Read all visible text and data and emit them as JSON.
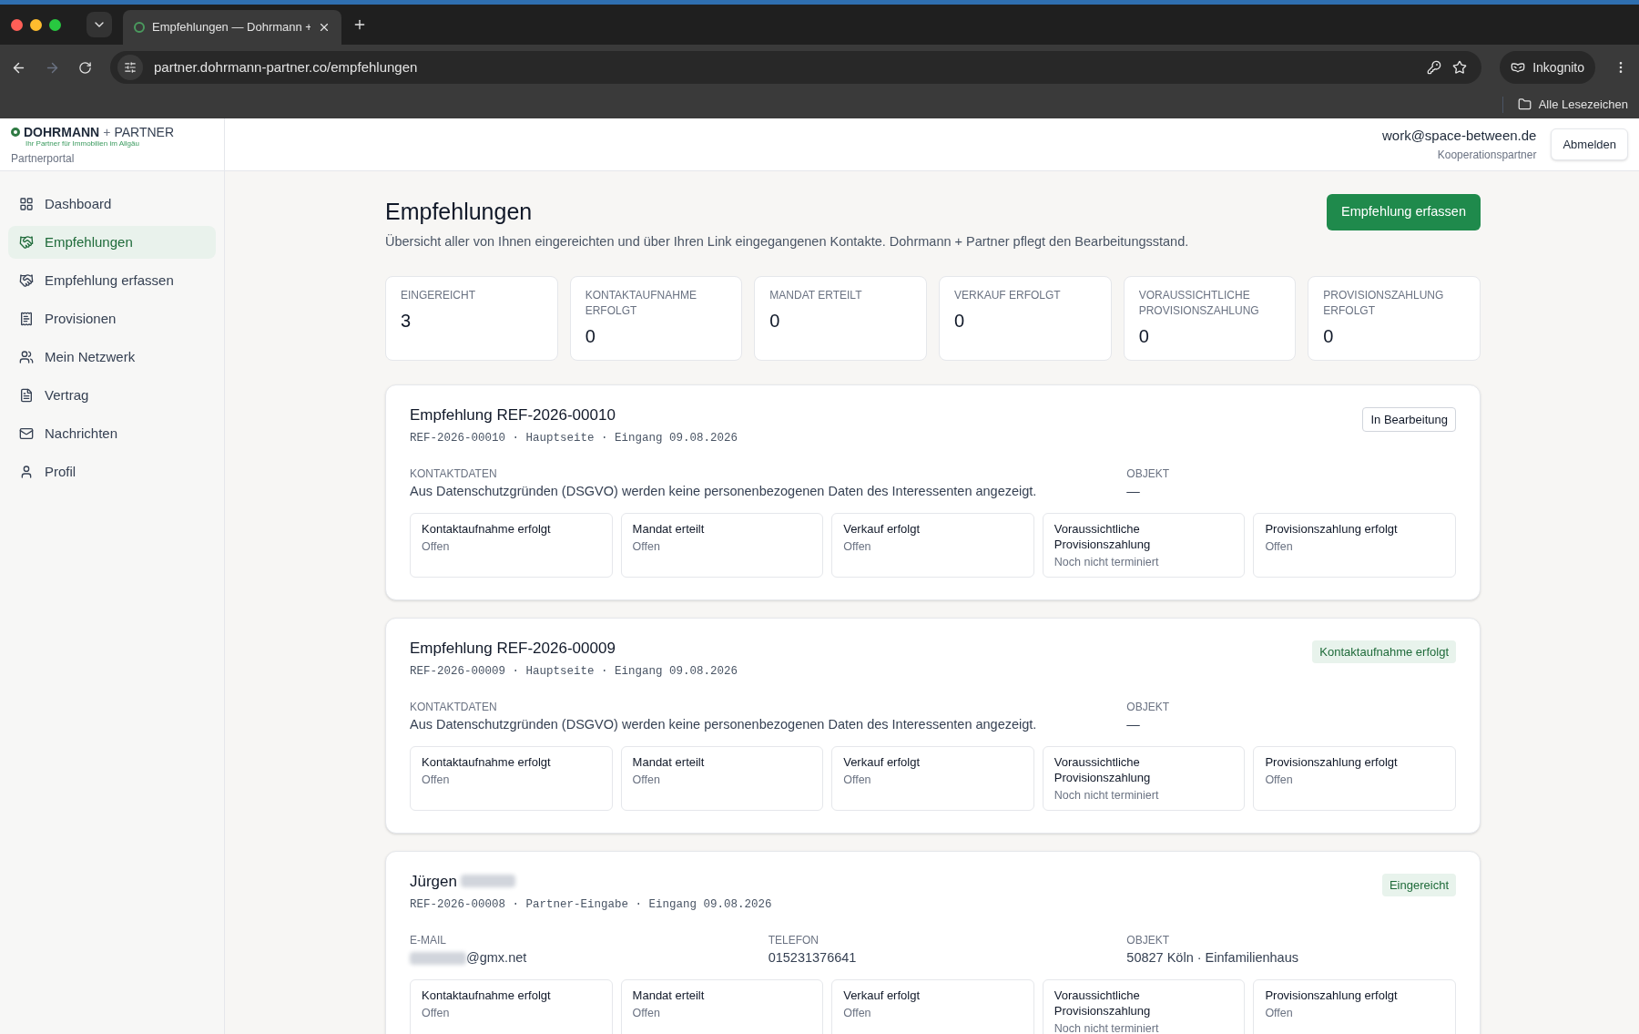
{
  "browser": {
    "tab_title": "Empfehlungen — Dohrmann +",
    "url": "partner.dohrmann-partner.co/empfehlungen",
    "incognito_label": "Inkognito",
    "bookmarks_label": "Alle Lesezeichen"
  },
  "brand": {
    "name_bold": "DOHRMANN",
    "plus": "+",
    "name_light": "PARTNER",
    "tagline": "Ihr Partner für Immobilien im Allgäu",
    "portal": "Partnerportal"
  },
  "user": {
    "email": "work@space-between.de",
    "role": "Kooperationspartner",
    "logout": "Abmelden"
  },
  "sidebar": {
    "items": [
      {
        "label": "Dashboard",
        "selected": false
      },
      {
        "label": "Empfehlungen",
        "selected": true
      },
      {
        "label": "Empfehlung erfassen",
        "selected": false
      },
      {
        "label": "Provisionen",
        "selected": false
      },
      {
        "label": "Mein Netzwerk",
        "selected": false
      },
      {
        "label": "Vertrag",
        "selected": false
      },
      {
        "label": "Nachrichten",
        "selected": false
      },
      {
        "label": "Profil",
        "selected": false
      }
    ]
  },
  "page": {
    "title": "Empfehlungen",
    "subtitle": "Übersicht aller von Ihnen eingereichten und über Ihren Link eingegangenen Kontakte. Dohrmann + Partner pflegt den Bearbeitungsstand.",
    "primary_button": "Empfehlung erfassen"
  },
  "stats": [
    {
      "label": "EINGEREICHT",
      "value": "3"
    },
    {
      "label": "KONTAKTAUFNAHME ERFOLGT",
      "value": "0"
    },
    {
      "label": "MANDAT ERTEILT",
      "value": "0"
    },
    {
      "label": "VERKAUF ERFOLGT",
      "value": "0"
    },
    {
      "label": "VORAUSSICHTLICHE PROVISIONSZAHLUNG",
      "value": "0"
    },
    {
      "label": "PROVISIONSZAHLUNG ERFOLGT",
      "value": "0"
    }
  ],
  "referrals": [
    {
      "title": "Empfehlung REF-2026-00010",
      "title_redacted": false,
      "meta": "REF-2026-00010 · Hauptseite · Eingang 09.08.2026",
      "status": {
        "label": "In Bearbeitung",
        "kind": "neutral"
      },
      "fields": [
        {
          "kind": "wide",
          "label": "KONTAKTDATEN",
          "value": "Aus Datenschutzgründen (DSGVO) werden keine personenbezogenen Daten des Interessenten angezeigt.",
          "redacted": false
        },
        {
          "kind": "normal",
          "label": "OBJEKT",
          "value": "—",
          "redacted": false
        }
      ],
      "steps": [
        {
          "label": "Kontaktaufnahme erfolgt",
          "value": "Offen"
        },
        {
          "label": "Mandat erteilt",
          "value": "Offen"
        },
        {
          "label": "Verkauf erfolgt",
          "value": "Offen"
        },
        {
          "label": "Voraussichtliche Provisionszahlung",
          "value": "Noch nicht terminiert"
        },
        {
          "label": "Provisionszahlung erfolgt",
          "value": "Offen"
        }
      ]
    },
    {
      "title": "Empfehlung REF-2026-00009",
      "title_redacted": false,
      "meta": "REF-2026-00009 · Hauptseite · Eingang 09.08.2026",
      "status": {
        "label": "Kontaktaufnahme erfolgt",
        "kind": "success"
      },
      "fields": [
        {
          "kind": "wide",
          "label": "KONTAKTDATEN",
          "value": "Aus Datenschutzgründen (DSGVO) werden keine personenbezogenen Daten des Interessenten angezeigt.",
          "redacted": false
        },
        {
          "kind": "normal",
          "label": "OBJEKT",
          "value": "—",
          "redacted": false
        }
      ],
      "steps": [
        {
          "label": "Kontaktaufnahme erfolgt",
          "value": "Offen"
        },
        {
          "label": "Mandat erteilt",
          "value": "Offen"
        },
        {
          "label": "Verkauf erfolgt",
          "value": "Offen"
        },
        {
          "label": "Voraussichtliche Provisionszahlung",
          "value": "Noch nicht terminiert"
        },
        {
          "label": "Provisionszahlung erfolgt",
          "value": "Offen"
        }
      ]
    },
    {
      "title": "Jürgen",
      "title_redacted": true,
      "meta": "REF-2026-00008 · Partner-Eingabe · Eingang 09.08.2026",
      "status": {
        "label": "Eingereicht",
        "kind": "success"
      },
      "fields": [
        {
          "kind": "normal",
          "label": "E-MAIL",
          "value": "@gmx.net",
          "redacted": true
        },
        {
          "kind": "normal",
          "label": "TELEFON",
          "value": "015231376641",
          "redacted": false
        },
        {
          "kind": "normal",
          "label": "OBJEKT",
          "value": "50827 Köln · Einfamilienhaus",
          "redacted": false
        }
      ],
      "steps": [
        {
          "label": "Kontaktaufnahme erfolgt",
          "value": "Offen"
        },
        {
          "label": "Mandat erteilt",
          "value": "Offen"
        },
        {
          "label": "Verkauf erfolgt",
          "value": "Offen"
        },
        {
          "label": "Voraussichtliche Provisionszahlung",
          "value": "Noch nicht terminiert"
        },
        {
          "label": "Provisionszahlung erfolgt",
          "value": "Offen"
        }
      ]
    }
  ]
}
